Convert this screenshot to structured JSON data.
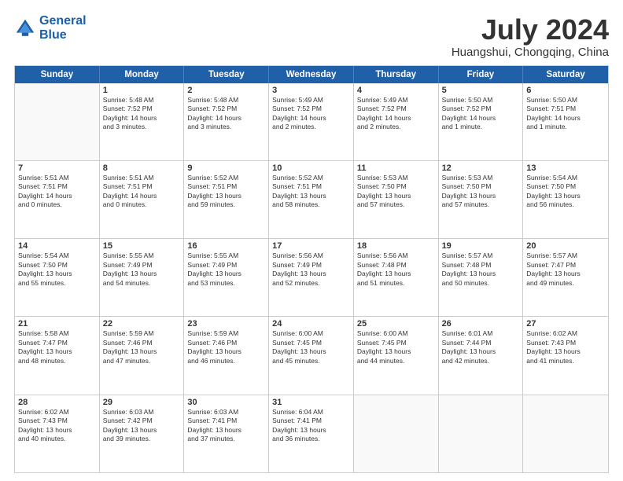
{
  "logo": {
    "line1": "General",
    "line2": "Blue"
  },
  "title": {
    "month": "July 2024",
    "location": "Huangshui, Chongqing, China"
  },
  "weekdays": [
    "Sunday",
    "Monday",
    "Tuesday",
    "Wednesday",
    "Thursday",
    "Friday",
    "Saturday"
  ],
  "rows": [
    [
      {
        "day": "",
        "info": ""
      },
      {
        "day": "1",
        "info": "Sunrise: 5:48 AM\nSunset: 7:52 PM\nDaylight: 14 hours\nand 3 minutes."
      },
      {
        "day": "2",
        "info": "Sunrise: 5:48 AM\nSunset: 7:52 PM\nDaylight: 14 hours\nand 3 minutes."
      },
      {
        "day": "3",
        "info": "Sunrise: 5:49 AM\nSunset: 7:52 PM\nDaylight: 14 hours\nand 2 minutes."
      },
      {
        "day": "4",
        "info": "Sunrise: 5:49 AM\nSunset: 7:52 PM\nDaylight: 14 hours\nand 2 minutes."
      },
      {
        "day": "5",
        "info": "Sunrise: 5:50 AM\nSunset: 7:52 PM\nDaylight: 14 hours\nand 1 minute."
      },
      {
        "day": "6",
        "info": "Sunrise: 5:50 AM\nSunset: 7:51 PM\nDaylight: 14 hours\nand 1 minute."
      }
    ],
    [
      {
        "day": "7",
        "info": "Sunrise: 5:51 AM\nSunset: 7:51 PM\nDaylight: 14 hours\nand 0 minutes."
      },
      {
        "day": "8",
        "info": "Sunrise: 5:51 AM\nSunset: 7:51 PM\nDaylight: 14 hours\nand 0 minutes."
      },
      {
        "day": "9",
        "info": "Sunrise: 5:52 AM\nSunset: 7:51 PM\nDaylight: 13 hours\nand 59 minutes."
      },
      {
        "day": "10",
        "info": "Sunrise: 5:52 AM\nSunset: 7:51 PM\nDaylight: 13 hours\nand 58 minutes."
      },
      {
        "day": "11",
        "info": "Sunrise: 5:53 AM\nSunset: 7:50 PM\nDaylight: 13 hours\nand 57 minutes."
      },
      {
        "day": "12",
        "info": "Sunrise: 5:53 AM\nSunset: 7:50 PM\nDaylight: 13 hours\nand 57 minutes."
      },
      {
        "day": "13",
        "info": "Sunrise: 5:54 AM\nSunset: 7:50 PM\nDaylight: 13 hours\nand 56 minutes."
      }
    ],
    [
      {
        "day": "14",
        "info": "Sunrise: 5:54 AM\nSunset: 7:50 PM\nDaylight: 13 hours\nand 55 minutes."
      },
      {
        "day": "15",
        "info": "Sunrise: 5:55 AM\nSunset: 7:49 PM\nDaylight: 13 hours\nand 54 minutes."
      },
      {
        "day": "16",
        "info": "Sunrise: 5:55 AM\nSunset: 7:49 PM\nDaylight: 13 hours\nand 53 minutes."
      },
      {
        "day": "17",
        "info": "Sunrise: 5:56 AM\nSunset: 7:49 PM\nDaylight: 13 hours\nand 52 minutes."
      },
      {
        "day": "18",
        "info": "Sunrise: 5:56 AM\nSunset: 7:48 PM\nDaylight: 13 hours\nand 51 minutes."
      },
      {
        "day": "19",
        "info": "Sunrise: 5:57 AM\nSunset: 7:48 PM\nDaylight: 13 hours\nand 50 minutes."
      },
      {
        "day": "20",
        "info": "Sunrise: 5:57 AM\nSunset: 7:47 PM\nDaylight: 13 hours\nand 49 minutes."
      }
    ],
    [
      {
        "day": "21",
        "info": "Sunrise: 5:58 AM\nSunset: 7:47 PM\nDaylight: 13 hours\nand 48 minutes."
      },
      {
        "day": "22",
        "info": "Sunrise: 5:59 AM\nSunset: 7:46 PM\nDaylight: 13 hours\nand 47 minutes."
      },
      {
        "day": "23",
        "info": "Sunrise: 5:59 AM\nSunset: 7:46 PM\nDaylight: 13 hours\nand 46 minutes."
      },
      {
        "day": "24",
        "info": "Sunrise: 6:00 AM\nSunset: 7:45 PM\nDaylight: 13 hours\nand 45 minutes."
      },
      {
        "day": "25",
        "info": "Sunrise: 6:00 AM\nSunset: 7:45 PM\nDaylight: 13 hours\nand 44 minutes."
      },
      {
        "day": "26",
        "info": "Sunrise: 6:01 AM\nSunset: 7:44 PM\nDaylight: 13 hours\nand 42 minutes."
      },
      {
        "day": "27",
        "info": "Sunrise: 6:02 AM\nSunset: 7:43 PM\nDaylight: 13 hours\nand 41 minutes."
      }
    ],
    [
      {
        "day": "28",
        "info": "Sunrise: 6:02 AM\nSunset: 7:43 PM\nDaylight: 13 hours\nand 40 minutes."
      },
      {
        "day": "29",
        "info": "Sunrise: 6:03 AM\nSunset: 7:42 PM\nDaylight: 13 hours\nand 39 minutes."
      },
      {
        "day": "30",
        "info": "Sunrise: 6:03 AM\nSunset: 7:41 PM\nDaylight: 13 hours\nand 37 minutes."
      },
      {
        "day": "31",
        "info": "Sunrise: 6:04 AM\nSunset: 7:41 PM\nDaylight: 13 hours\nand 36 minutes."
      },
      {
        "day": "",
        "info": ""
      },
      {
        "day": "",
        "info": ""
      },
      {
        "day": "",
        "info": ""
      }
    ]
  ]
}
